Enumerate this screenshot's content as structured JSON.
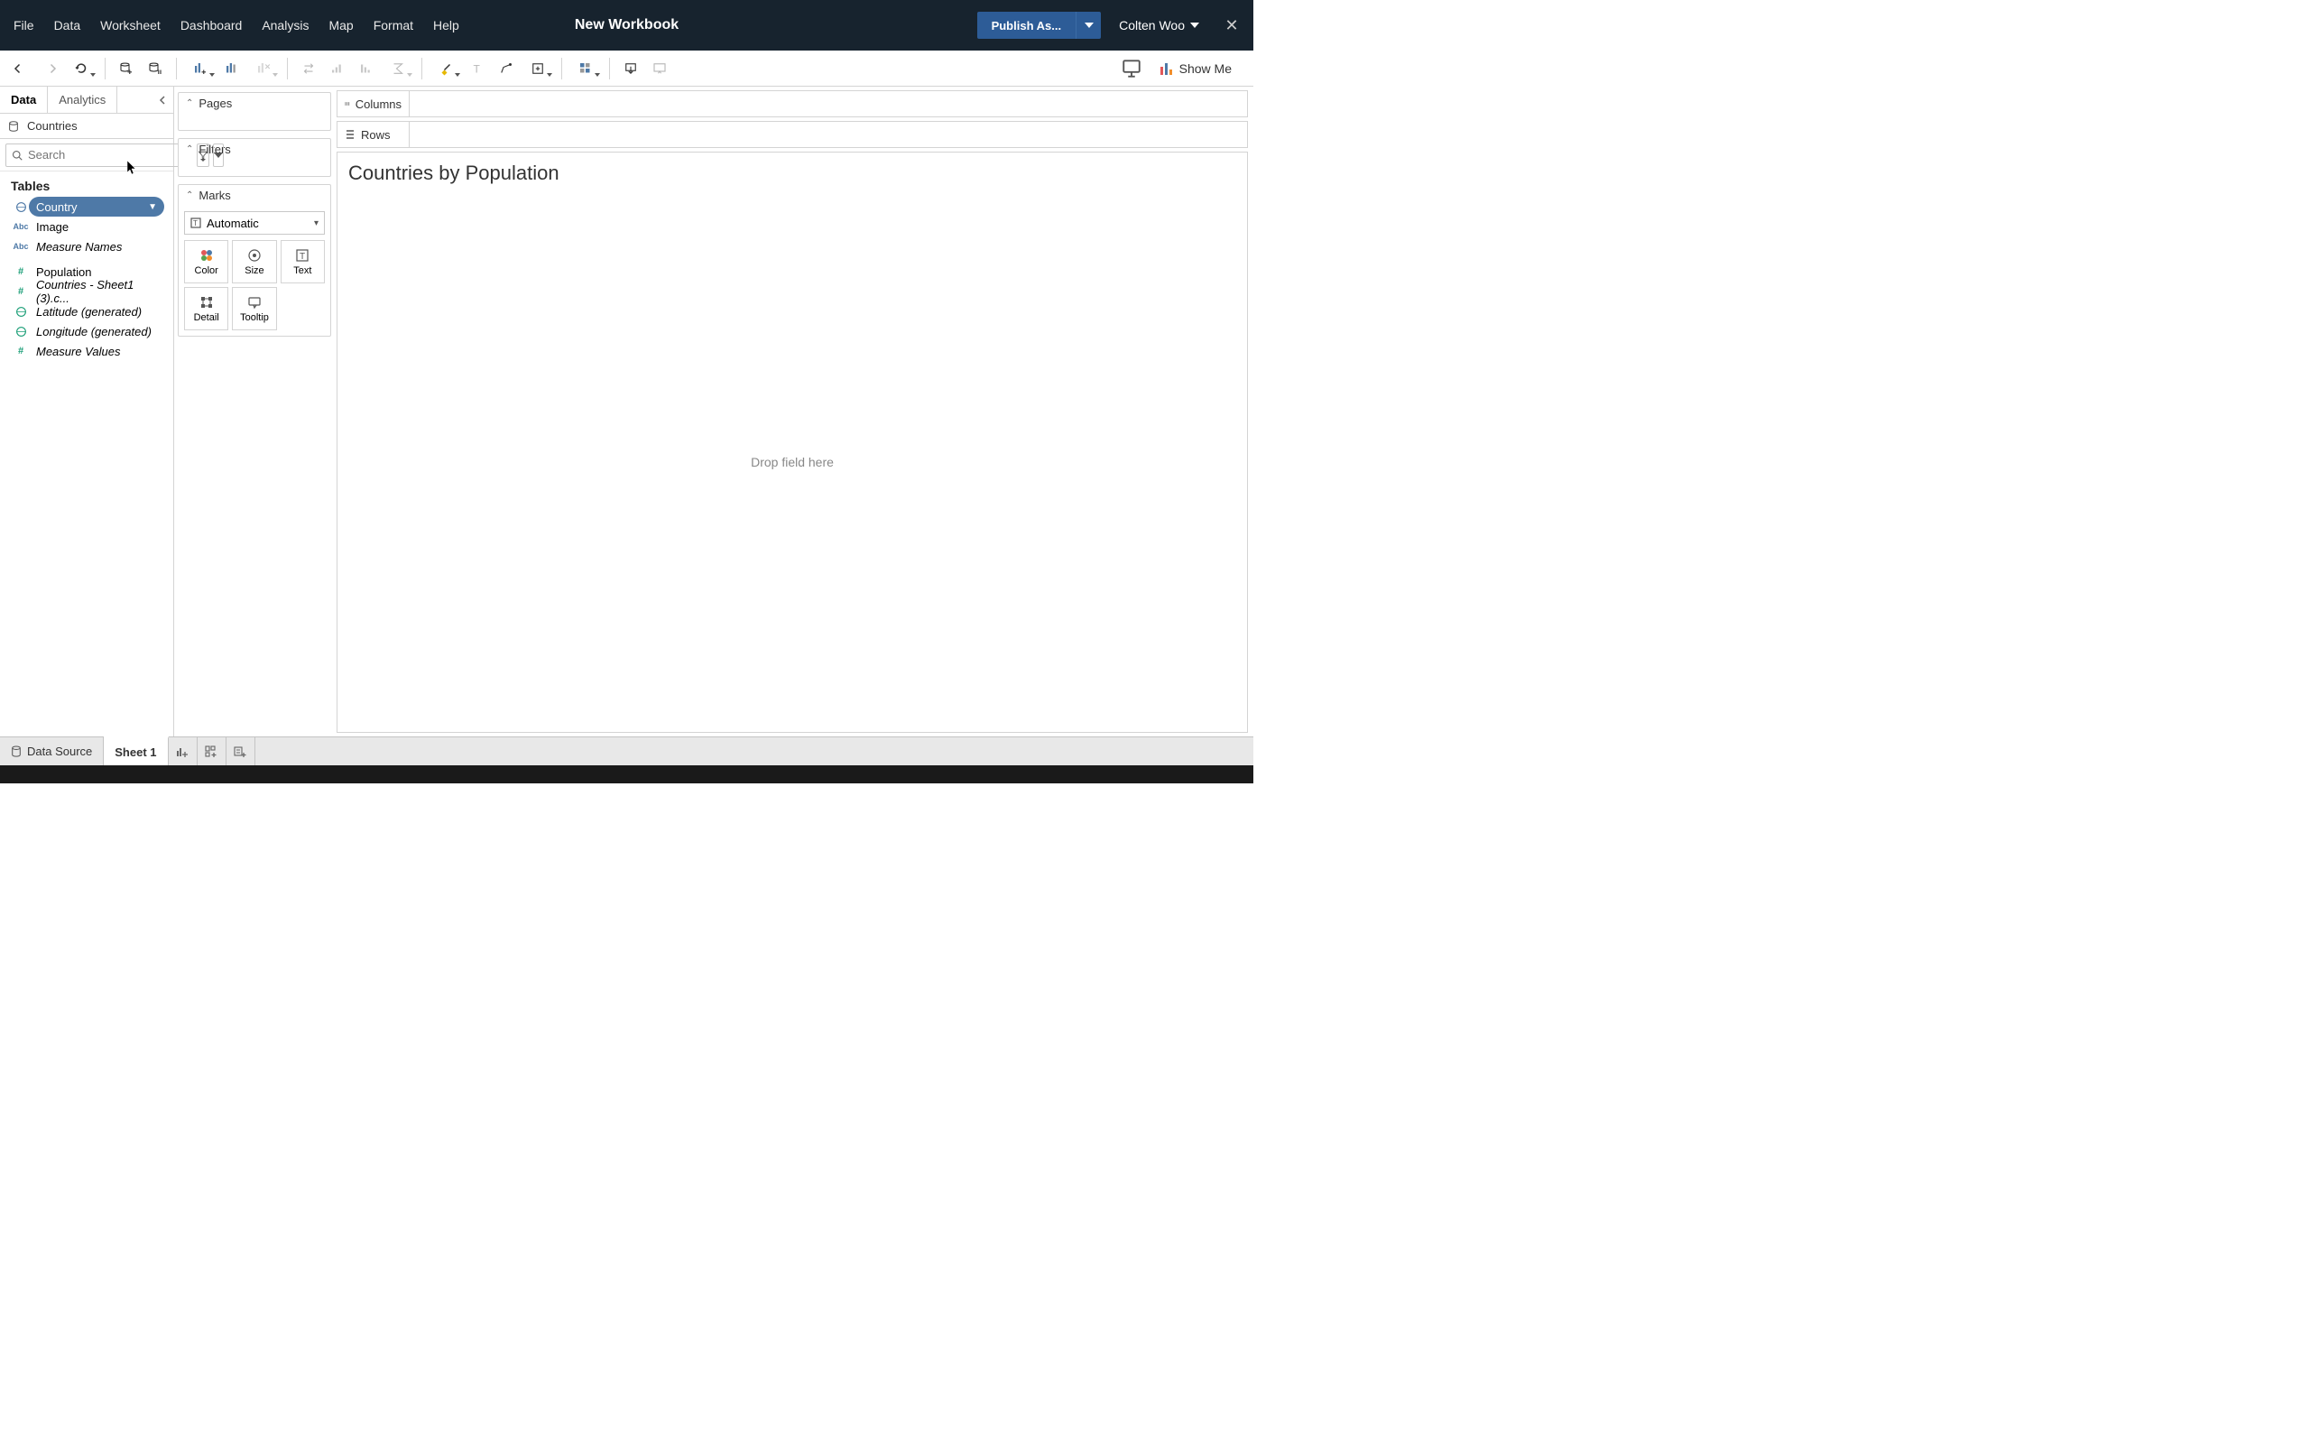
{
  "titlebar": {
    "title": "New Workbook",
    "menus": [
      "File",
      "Data",
      "Worksheet",
      "Dashboard",
      "Analysis",
      "Map",
      "Format",
      "Help"
    ],
    "publish_label": "Publish As...",
    "user_label": "Colten Woo"
  },
  "toolbar": {
    "show_me_label": "Show Me"
  },
  "sidebar": {
    "tabs": {
      "data": "Data",
      "analytics": "Analytics"
    },
    "datasource": "Countries",
    "search_placeholder": "Search",
    "tables_header": "Tables",
    "fields": [
      {
        "name": "Country",
        "type": "geo",
        "color": "blue",
        "italic": false,
        "selected": true
      },
      {
        "name": "Image",
        "type": "abc",
        "color": "blue",
        "italic": false,
        "selected": false
      },
      {
        "name": "Measure Names",
        "type": "abc",
        "color": "blue",
        "italic": true,
        "selected": false
      },
      {
        "name": "Population",
        "type": "num",
        "color": "green",
        "italic": false,
        "selected": false
      },
      {
        "name": "Countries - Sheet1 (3).c...",
        "type": "num",
        "color": "green",
        "italic": true,
        "selected": false
      },
      {
        "name": "Latitude (generated)",
        "type": "geo",
        "color": "green",
        "italic": true,
        "selected": false
      },
      {
        "name": "Longitude (generated)",
        "type": "geo",
        "color": "green",
        "italic": true,
        "selected": false
      },
      {
        "name": "Measure Values",
        "type": "num",
        "color": "green",
        "italic": true,
        "selected": false
      }
    ]
  },
  "cards": {
    "pages": "Pages",
    "filters": "Filters",
    "marks": "Marks",
    "mark_type": "Automatic",
    "mark_buttons": {
      "color": "Color",
      "size": "Size",
      "text": "Text",
      "detail": "Detail",
      "tooltip": "Tooltip"
    }
  },
  "shelves": {
    "columns": "Columns",
    "rows": "Rows"
  },
  "view": {
    "title": "Countries by Population",
    "drop_hint": "Drop field here"
  },
  "bottombar": {
    "datasource": "Data Source",
    "sheet": "Sheet 1"
  }
}
